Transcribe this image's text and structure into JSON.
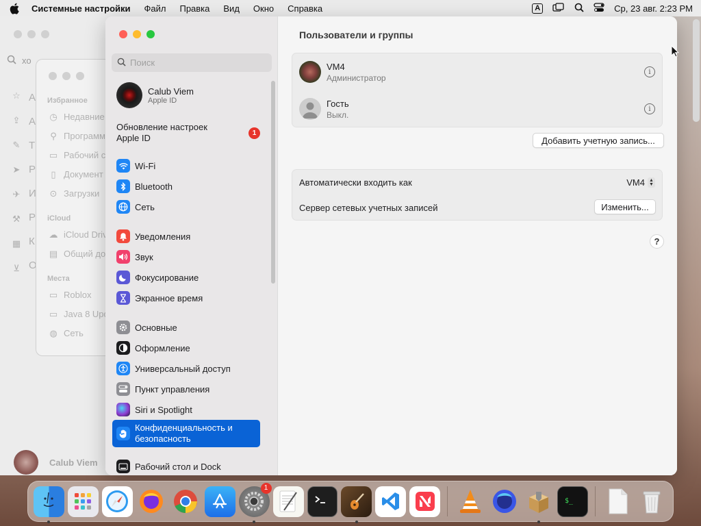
{
  "menubar": {
    "app_name": "Системные настройки",
    "items": [
      "Файл",
      "Правка",
      "Вид",
      "Окно",
      "Справка"
    ],
    "input_indicator": "A",
    "datetime": "Ср, 23 авг.  2:23 PM"
  },
  "finder_bg": {
    "search_text": "хо",
    "letters": [
      "А",
      "А",
      "Т",
      "Р",
      "И",
      "Р",
      "К",
      "О"
    ],
    "user_name": "Calub Viem"
  },
  "finder2": {
    "section_favorites": "Избранное",
    "favorites": [
      "Недавние",
      "Программ",
      "Рабочий с",
      "Документ",
      "Загрузки"
    ],
    "section_icloud": "iCloud",
    "icloud": [
      "iCloud Driv",
      "Общий до"
    ],
    "section_places": "Места",
    "places": [
      "Roblox",
      "Java 8 Upd",
      "Сеть"
    ]
  },
  "sidebar": {
    "search_placeholder": "Поиск",
    "account_name": "Calub Viem",
    "account_sub": "Apple ID",
    "update_text_1": "Обновление настроек",
    "update_text_2": "Apple ID",
    "update_badge": "1",
    "items": [
      {
        "label": "Wi-Fi",
        "icon": "wifi-icon",
        "color": "#1f86f5"
      },
      {
        "label": "Bluetooth",
        "icon": "bluetooth-icon",
        "color": "#1f86f5"
      },
      {
        "label": "Сеть",
        "icon": "globe-icon",
        "color": "#1f86f5"
      },
      {
        "label": "Уведомления",
        "icon": "bell-icon",
        "color": "#f24a3d"
      },
      {
        "label": "Звук",
        "icon": "speaker-icon",
        "color": "#f1416c"
      },
      {
        "label": "Фокусирование",
        "icon": "moon-icon",
        "color": "#5b58d6"
      },
      {
        "label": "Экранное время",
        "icon": "hourglass-icon",
        "color": "#5b58d6"
      },
      {
        "label": "Основные",
        "icon": "gear-icon",
        "color": "#8e8e93"
      },
      {
        "label": "Оформление",
        "icon": "appearance-icon",
        "color": "#1c1c1e"
      },
      {
        "label": "Универсальный доступ",
        "icon": "accessibility-icon",
        "color": "#1f86f5"
      },
      {
        "label": "Пункт управления",
        "icon": "control-center-icon",
        "color": "#8e8e93"
      },
      {
        "label": "Siri и Spotlight",
        "icon": "siri-icon",
        "color": "#a33bd1"
      },
      {
        "label": "Конфиденциальность и безопасность",
        "icon": "hand-icon",
        "color": "#1f86f5"
      },
      {
        "label": "Рабочий стол и Dock",
        "icon": "dock-icon",
        "color": "#1c1c1e"
      }
    ]
  },
  "content": {
    "title": "Пользователи и группы",
    "users": [
      {
        "name": "VM4",
        "role": "Администратор"
      },
      {
        "name": "Гость",
        "role": "Выкл."
      }
    ],
    "add_account_button": "Добавить учетную запись...",
    "auto_login_label": "Автоматически входить как",
    "auto_login_value": "VM4",
    "network_server_label": "Сервер сетевых учетных записей",
    "edit_button": "Изменить...",
    "help_button": "?"
  },
  "dock": {
    "items": [
      {
        "name": "finder-icon",
        "running": true
      },
      {
        "name": "launchpad-icon",
        "running": false
      },
      {
        "name": "safari-icon",
        "running": false
      },
      {
        "name": "firefox-icon",
        "running": false
      },
      {
        "name": "chrome-icon",
        "running": false
      },
      {
        "name": "app-store-icon",
        "running": false
      },
      {
        "name": "system-settings-icon",
        "running": true,
        "badge": "1"
      },
      {
        "name": "textedit-icon",
        "running": false
      },
      {
        "name": "terminal-icon",
        "running": false
      },
      {
        "name": "garageband-icon",
        "running": true
      },
      {
        "name": "vscode-icon",
        "running": false
      },
      {
        "name": "news-icon",
        "running": false
      },
      {
        "name": "vlc-icon",
        "running": false
      },
      {
        "name": "firefox-dev-icon",
        "running": false
      },
      {
        "name": "installer-icon",
        "running": true
      },
      {
        "name": "script-terminal-icon",
        "running": false
      },
      {
        "name": "document-icon",
        "running": false
      },
      {
        "name": "trash-icon",
        "running": false
      }
    ]
  }
}
